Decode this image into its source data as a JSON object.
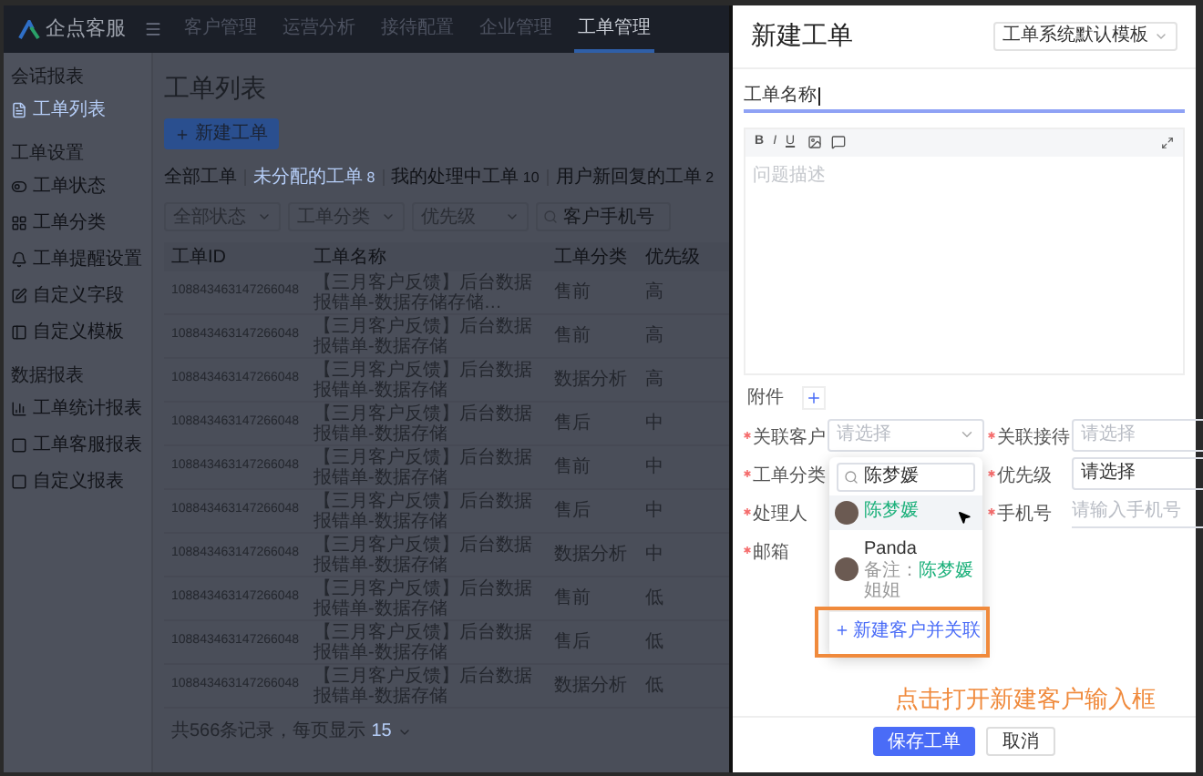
{
  "top_nav": {
    "logo": "企点客服",
    "tabs": [
      {
        "label": "客户管理",
        "selected": false
      },
      {
        "label": "运营分析",
        "selected": false
      },
      {
        "label": "接待配置",
        "selected": false
      },
      {
        "label": "企业管理",
        "selected": false
      },
      {
        "label": "工单管理",
        "selected": true
      }
    ]
  },
  "sidebar": {
    "sections": [
      {
        "title": "会话报表",
        "items": [
          {
            "label": "工单列表",
            "selected": true
          }
        ]
      },
      {
        "title": "工单设置",
        "items": [
          {
            "label": "工单状态",
            "selected": false
          },
          {
            "label": "工单分类",
            "selected": false
          },
          {
            "label": "工单提醒设置",
            "selected": false
          },
          {
            "label": "自定义字段",
            "selected": false
          },
          {
            "label": "自定义模板",
            "selected": false
          }
        ]
      },
      {
        "title": "数据报表",
        "items": [
          {
            "label": "工单统计报表",
            "selected": false
          },
          {
            "label": "工单客服报表",
            "selected": false
          },
          {
            "label": "自定义报表",
            "selected": false
          }
        ]
      }
    ]
  },
  "main": {
    "title": "工单列表",
    "new_button": "新建工单",
    "tabs": [
      {
        "label": "全部工单",
        "selected": false
      },
      {
        "label": "未分配的工单",
        "count": "8",
        "selected": true
      },
      {
        "label": "我的处理中工单",
        "count": "10",
        "selected": false
      },
      {
        "label": "用户新回复的工单",
        "count": "2",
        "selected": false
      }
    ],
    "filters": [
      {
        "kind": "select",
        "label": "全部状态"
      },
      {
        "kind": "select",
        "label": "工单分类"
      },
      {
        "kind": "select",
        "label": "优先级"
      },
      {
        "kind": "search",
        "placeholder": "客户手机号"
      }
    ],
    "table": {
      "columns": [
        "工单ID",
        "工单名称",
        "工单分类",
        "优先级"
      ],
      "rows": [
        [
          "108843463147266048",
          "【三月客户反馈】后台数据报错单-数据存储存储…",
          "售前",
          "高"
        ],
        [
          "108843463147266048",
          "【三月客户反馈】后台数据报错单-数据存储",
          "售前",
          "高"
        ],
        [
          "108843463147266048",
          "【三月客户反馈】后台数据报错单-数据存储",
          "数据分析",
          "高"
        ],
        [
          "108843463147266048",
          "【三月客户反馈】后台数据报错单-数据存储",
          "售后",
          "中"
        ],
        [
          "108843463147266048",
          "【三月客户反馈】后台数据报错单-数据存储",
          "售前",
          "中"
        ],
        [
          "108843463147266048",
          "【三月客户反馈】后台数据报错单-数据存储",
          "售后",
          "中"
        ],
        [
          "108843463147266048",
          "【三月客户反馈】后台数据报错单-数据存储",
          "数据分析",
          "中"
        ],
        [
          "108843463147266048",
          "【三月客户反馈】后台数据报错单-数据存储",
          "售前",
          "低"
        ],
        [
          "108843463147266048",
          "【三月客户反馈】后台数据报错单-数据存储",
          "售后",
          "低"
        ],
        [
          "108843463147266048",
          "【三月客户反馈】后台数据报错单-数据存储",
          "数据分析",
          "低"
        ]
      ]
    },
    "footer": {
      "text": "共566条记录，每页显示",
      "page_size": "15"
    }
  },
  "drawer": {
    "title": "新建工单",
    "template": "工单系统默认模板",
    "name_value": "工单名称",
    "editor": {
      "toolbar": [
        "B",
        "I",
        "U"
      ],
      "placeholder": "问题描述"
    },
    "attachment_label": "附件",
    "fields": [
      {
        "label": "关联客户",
        "required": true,
        "kind": "select",
        "placeholder": "请选择"
      },
      {
        "label": "关联接待",
        "required": true,
        "kind": "select",
        "placeholder": "请选择"
      },
      {
        "label": "工单分类",
        "required": true,
        "kind": "covered"
      },
      {
        "label": "优先级",
        "required": true,
        "kind": "select",
        "value": "请选择"
      },
      {
        "label": "处理人",
        "required": true,
        "kind": "covered"
      },
      {
        "label": "手机号",
        "required": true,
        "kind": "input",
        "placeholder": "请输入手机号"
      },
      {
        "label": "邮箱",
        "required": true,
        "kind": "covered"
      }
    ],
    "popup": {
      "search_value": "陈梦媛",
      "options": [
        {
          "name": "陈梦媛",
          "selected": true
        },
        {
          "name": "Panda",
          "note_prefix": "备注：",
          "note_match": "陈梦媛",
          "note_rest": "姐姐",
          "selected": false
        }
      ],
      "create_link": "新建客户并关联"
    },
    "annotation": "点击打开新建客户输入框",
    "buttons": [
      {
        "label": "保存工单",
        "kind": "primary"
      },
      {
        "label": "取消",
        "kind": "secondary"
      }
    ]
  }
}
